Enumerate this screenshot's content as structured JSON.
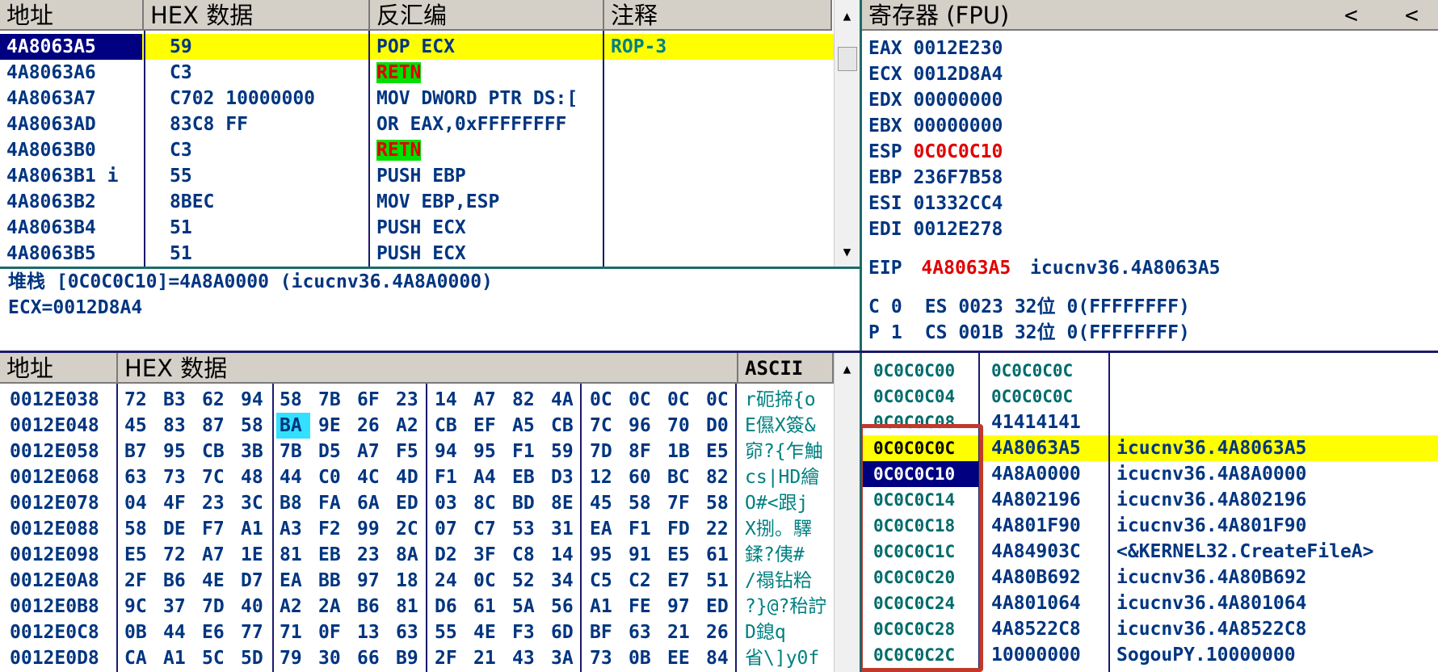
{
  "disasm": {
    "headers": {
      "addr": "地址",
      "hex": "HEX 数据",
      "asm": "反汇编",
      "comment": "注释"
    },
    "rows": [
      {
        "addr": "4A8063A5",
        "hex": "59",
        "asm": "POP ECX",
        "comment": "ROP-3"
      },
      {
        "addr": "4A8063A6",
        "hex": "C3",
        "asm": "RETN",
        "comment": ""
      },
      {
        "addr": "4A8063A7",
        "hex": "C702 10000000",
        "asm": "MOV DWORD PTR DS:[",
        "comment": ""
      },
      {
        "addr": "4A8063AD",
        "hex": "83C8 FF",
        "asm": "OR EAX,0xFFFFFFFF",
        "comment": ""
      },
      {
        "addr": "4A8063B0",
        "hex": "C3",
        "asm": "RETN",
        "comment": ""
      },
      {
        "addr": "4A8063B1 i",
        "hex": "55",
        "asm": "PUSH EBP",
        "comment": ""
      },
      {
        "addr": "4A8063B2",
        "hex": "8BEC",
        "asm": "MOV EBP,ESP",
        "comment": ""
      },
      {
        "addr": "4A8063B4",
        "hex": "51",
        "asm": "PUSH ECX",
        "comment": ""
      },
      {
        "addr": "4A8063B5",
        "hex": "51",
        "asm": "PUSH ECX",
        "comment": ""
      }
    ]
  },
  "info": {
    "line1": "堆栈 [0C0C0C10]=4A8A0000 (icucnv36.4A8A0000)",
    "line2": "ECX=0012D8A4"
  },
  "registers": {
    "title": "寄存器 (FPU)",
    "nav_left": "<",
    "nav_right": "<",
    "regs": [
      {
        "name": "EAX",
        "value": "0012E230"
      },
      {
        "name": "ECX",
        "value": "0012D8A4"
      },
      {
        "name": "EDX",
        "value": "00000000"
      },
      {
        "name": "EBX",
        "value": "00000000"
      },
      {
        "name": "ESP",
        "value": "0C0C0C10"
      },
      {
        "name": "EBP",
        "value": "236F7B58"
      },
      {
        "name": "ESI",
        "value": "01332CC4"
      },
      {
        "name": "EDI",
        "value": "0012E278"
      }
    ],
    "eip": {
      "name": "EIP",
      "value": "4A8063A5",
      "desc": "icucnv36.4A8063A5"
    },
    "flags": [
      {
        "flag": "C",
        "bit": "0",
        "seg": "ES",
        "sel": "0023",
        "width": "32位",
        "limit": "0(FFFFFFFF)"
      },
      {
        "flag": "P",
        "bit": "1",
        "seg": "CS",
        "sel": "001B",
        "width": "32位",
        "limit": "0(FFFFFFFF)"
      }
    ]
  },
  "dump": {
    "headers": {
      "addr": "地址",
      "hex": "HEX 数据",
      "ascii": "ASCII"
    },
    "rows": [
      {
        "addr": "0012E038",
        "bytes": [
          "72",
          "B3",
          "62",
          "94",
          "58",
          "7B",
          "6F",
          "23",
          "14",
          "A7",
          "82",
          "4A",
          "0C",
          "0C",
          "0C",
          "0C"
        ],
        "ascii": "r砈揥{o"
      },
      {
        "addr": "0012E048",
        "bytes": [
          "45",
          "83",
          "87",
          "58",
          "BA",
          "9E",
          "26",
          "A2",
          "CB",
          "EF",
          "A5",
          "CB",
          "7C",
          "96",
          "70",
          "D0"
        ],
        "ascii": "E儑X簽&"
      },
      {
        "addr": "0012E058",
        "bytes": [
          "B7",
          "95",
          "CB",
          "3B",
          "7B",
          "D5",
          "A7",
          "F5",
          "94",
          "95",
          "F1",
          "59",
          "7D",
          "8F",
          "1B",
          "E5"
        ],
        "ascii": "窌?{乍鮋"
      },
      {
        "addr": "0012E068",
        "bytes": [
          "63",
          "73",
          "7C",
          "48",
          "44",
          "C0",
          "4C",
          "4D",
          "F1",
          "A4",
          "EB",
          "D3",
          "12",
          "60",
          "BC",
          "82"
        ],
        "ascii": "cs|HD繪"
      },
      {
        "addr": "0012E078",
        "bytes": [
          "04",
          "4F",
          "23",
          "3C",
          "B8",
          "FA",
          "6A",
          "ED",
          "03",
          "8C",
          "BD",
          "8E",
          "45",
          "58",
          "7F",
          "58"
        ],
        "ascii": "O#<跟j"
      },
      {
        "addr": "0012E088",
        "bytes": [
          "58",
          "DE",
          "F7",
          "A1",
          "A3",
          "F2",
          "99",
          "2C",
          "07",
          "C7",
          "53",
          "31",
          "EA",
          "F1",
          "FD",
          "22"
        ],
        "ascii": "X捌。驛"
      },
      {
        "addr": "0012E098",
        "bytes": [
          "E5",
          "72",
          "A7",
          "1E",
          "81",
          "EB",
          "23",
          "8A",
          "D2",
          "3F",
          "C8",
          "14",
          "95",
          "91",
          "E5",
          "61"
        ],
        "ascii": "鍒?侇#"
      },
      {
        "addr": "0012E0A8",
        "bytes": [
          "2F",
          "B6",
          "4E",
          "D7",
          "EA",
          "BB",
          "97",
          "18",
          "24",
          "0C",
          "52",
          "34",
          "C5",
          "C2",
          "E7",
          "51"
        ],
        "ascii": "/禢钻粭"
      },
      {
        "addr": "0012E0B8",
        "bytes": [
          "9C",
          "37",
          "7D",
          "40",
          "A2",
          "2A",
          "B6",
          "81",
          "D6",
          "61",
          "5A",
          "56",
          "A1",
          "FE",
          "97",
          "ED"
        ],
        "ascii": "?}@?秮詝"
      },
      {
        "addr": "0012E0C8",
        "bytes": [
          "0B",
          "44",
          "E6",
          "77",
          "71",
          "0F",
          "13",
          "63",
          "55",
          "4E",
          "F3",
          "6D",
          "BF",
          "63",
          "21",
          "26"
        ],
        "ascii": "D鎴q"
      },
      {
        "addr": "0012E0D8",
        "bytes": [
          "CA",
          "A1",
          "5C",
          "5D",
          "79",
          "30",
          "66",
          "B9",
          "2F",
          "21",
          "43",
          "3A",
          "73",
          "0B",
          "EE",
          "84"
        ],
        "ascii": "省\\]y0f"
      }
    ]
  },
  "stack": {
    "rows": [
      {
        "addr": "0C0C0C00",
        "value": "0C0C0C0C",
        "comment": ""
      },
      {
        "addr": "0C0C0C04",
        "value": "0C0C0C0C",
        "comment": ""
      },
      {
        "addr": "0C0C0C08",
        "value": "41414141",
        "comment": ""
      },
      {
        "addr": "0C0C0C0C",
        "value": "4A8063A5",
        "comment": "icucnv36.4A8063A5"
      },
      {
        "addr": "0C0C0C10",
        "value": "4A8A0000",
        "comment": "icucnv36.4A8A0000"
      },
      {
        "addr": "0C0C0C14",
        "value": "4A802196",
        "comment": "icucnv36.4A802196"
      },
      {
        "addr": "0C0C0C18",
        "value": "4A801F90",
        "comment": "icucnv36.4A801F90"
      },
      {
        "addr": "0C0C0C1C",
        "value": "4A84903C",
        "comment": "<&KERNEL32.CreateFileA>"
      },
      {
        "addr": "0C0C0C20",
        "value": "4A80B692",
        "comment": "icucnv36.4A80B692"
      },
      {
        "addr": "0C0C0C24",
        "value": "4A801064",
        "comment": "icucnv36.4A801064"
      },
      {
        "addr": "0C0C0C28",
        "value": "4A8522C8",
        "comment": "icucnv36.4A8522C8"
      },
      {
        "addr": "0C0C0C2C",
        "value": "10000000",
        "comment": "SogouPY.10000000"
      }
    ]
  },
  "colors": {
    "highlight": "#ffff00",
    "selection": "#000080",
    "retn_bg": "#00e000",
    "red": "#e00000",
    "text": "#003580",
    "frame": "#c0392b"
  }
}
